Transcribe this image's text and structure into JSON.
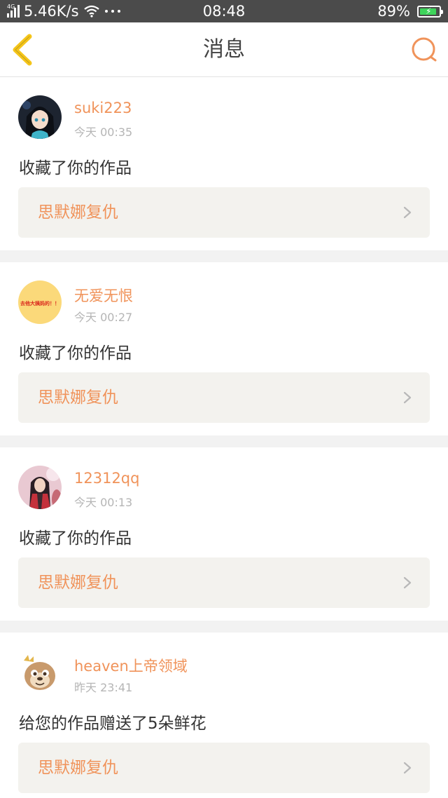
{
  "status_bar": {
    "network_label": "4G",
    "speed": "5.46K/s",
    "time": "08:48",
    "battery": "89%",
    "battery_level": 0.89,
    "battery_color": "#3ed45b"
  },
  "nav": {
    "title": "消息",
    "back_icon": "chevron-left-icon",
    "search_icon": "search-icon",
    "back_color": "#f5c51a",
    "search_color": "#f0935a"
  },
  "messages": [
    {
      "user": "suki223",
      "time": "今天 00:35",
      "action": "收藏了你的作品",
      "work_title": "思默娜复仇",
      "avatar": "anime-girl-avatar"
    },
    {
      "user": "无爱无恨",
      "time": "今天 00:27",
      "action": "收藏了你的作品",
      "work_title": "思默娜复仇",
      "avatar": "text-avatar",
      "avatar_text": "去他大姨妈的！！"
    },
    {
      "user": "12312qq",
      "time": "今天 00:13",
      "action": "收藏了你的作品",
      "work_title": "思默娜复仇",
      "avatar": "costume-character-avatar"
    },
    {
      "user": "heaven上帝领域",
      "time": "昨天 23:41",
      "action": "给您的作品赠送了5朵鲜花",
      "work_title": "思默娜复仇",
      "avatar": "cartoon-animal-avatar"
    }
  ],
  "colors": {
    "accent": "#f0935a",
    "background": "#f2f2f2",
    "card": "#ffffff",
    "link_bg": "#f3f2ee"
  }
}
